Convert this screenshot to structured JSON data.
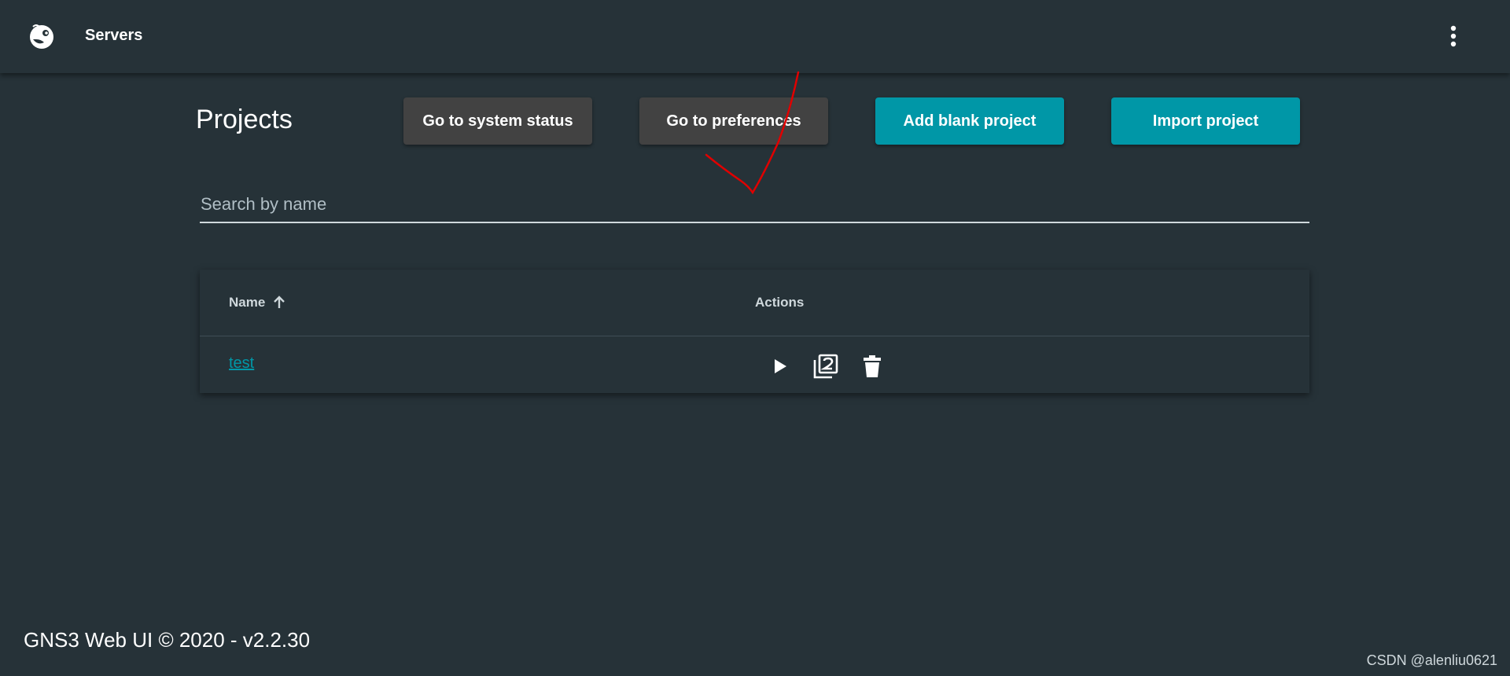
{
  "header": {
    "title": "Servers",
    "logo_icon": "gns3-chameleon-logo",
    "menu_icon": "more-vert-icon"
  },
  "page": {
    "title": "Projects"
  },
  "buttons": {
    "system_status": "Go to system status",
    "preferences": "Go to preferences",
    "add_blank": "Add blank project",
    "import": "Import project"
  },
  "search": {
    "placeholder": "Search by name",
    "value": ""
  },
  "table": {
    "columns": [
      {
        "label": "Name",
        "sort": "ascending"
      },
      {
        "label": "Actions"
      }
    ],
    "rows": [
      {
        "name": "test",
        "actions": [
          "play-icon",
          "duplicate-icon",
          "delete-icon"
        ]
      }
    ]
  },
  "footer": {
    "text": "GNS3 Web UI © 2020 - v2.2.30"
  },
  "watermark": "CSDN @alenliu0621",
  "colors": {
    "background": "#263238",
    "accent": "#0097a7",
    "button_dark": "#424242",
    "annotation": "#e00000"
  }
}
